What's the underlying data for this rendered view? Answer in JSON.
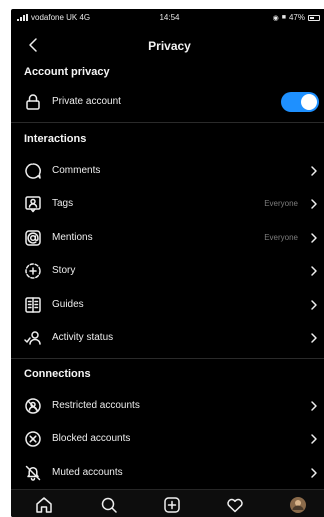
{
  "status_bar": {
    "carrier": "vodafone UK 4G",
    "time": "14:54",
    "battery": "47%"
  },
  "header": {
    "title": "Privacy"
  },
  "sections": {
    "account_privacy": {
      "title": "Account privacy",
      "private_account": {
        "label": "Private account",
        "toggle_on": true
      }
    },
    "interactions": {
      "title": "Interactions",
      "items": [
        {
          "label": "Comments",
          "value": ""
        },
        {
          "label": "Tags",
          "value": "Everyone"
        },
        {
          "label": "Mentions",
          "value": "Everyone"
        },
        {
          "label": "Story",
          "value": ""
        },
        {
          "label": "Guides",
          "value": ""
        },
        {
          "label": "Activity status",
          "value": ""
        }
      ]
    },
    "connections": {
      "title": "Connections",
      "items": [
        {
          "label": "Restricted accounts"
        },
        {
          "label": "Blocked accounts"
        },
        {
          "label": "Muted accounts"
        }
      ]
    }
  },
  "tab_bar": {
    "tabs": [
      "home-icon",
      "search-icon",
      "new-post-icon",
      "activity-heart-icon",
      "profile-avatar"
    ]
  },
  "colors": {
    "background": "#000000",
    "toggle_on": "#1e90ff",
    "secondary_text": "#7d7d7d"
  }
}
